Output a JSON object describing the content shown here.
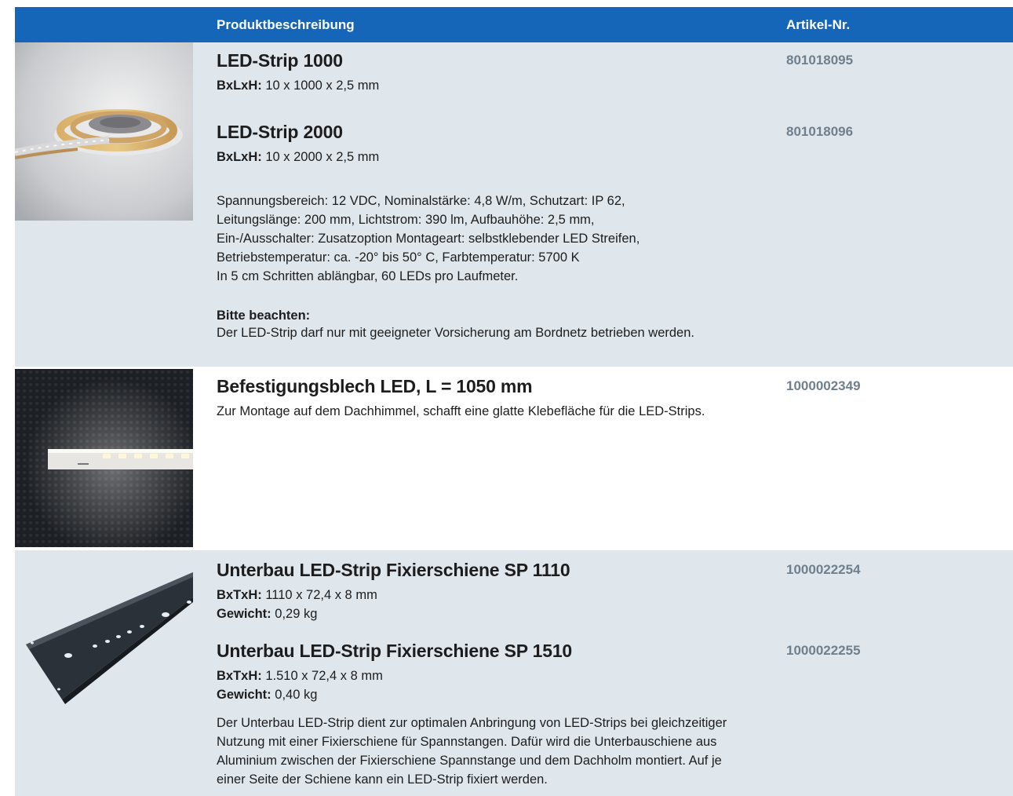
{
  "header": {
    "description": "Produktbeschreibung",
    "article_no": "Artikel-Nr."
  },
  "products": {
    "led_strip": {
      "image_icon": "led-strip-reel-photo",
      "items": [
        {
          "title": "LED-Strip 1000",
          "dim_label": "BxLxH:",
          "dim_value": " 10 x 1000 x 2,5 mm",
          "article": "801018095"
        },
        {
          "title": "LED-Strip 2000",
          "dim_label": "BxLxH:",
          "dim_value": " 10 x 2000 x 2,5 mm",
          "article": "801018096"
        }
      ],
      "specs": [
        "Spannungsbereich: 12 VDC, Nominalstärke: 4,8 W/m, Schutzart: IP 62,",
        "Leitungslänge: 200 mm, Lichtstrom: 390 lm, Aufbauhöhe: 2,5 mm,",
        "Ein-/Ausschalter: Zusatzoption Montageart: selbstklebender LED Streifen,",
        "Betriebstemperatur: ca. -20° bis 50° C, Farbtemperatur: 5700 K",
        "In 5 cm Schritten ablängbar, 60 LEDs pro Laufmeter."
      ],
      "note_label": "Bitte beachten:",
      "note_text": "Der LED-Strip darf nur mit geeigneter Vorsicherung am Bordnetz betrieben werden."
    },
    "bracket": {
      "image_icon": "mounting-plate-photo",
      "title": "Befestigungsblech LED, L = 1050 mm",
      "description": "Zur Montage auf dem Dachhimmel, schafft eine glatte Klebefläche für die LED-Strips.",
      "article": "1000002349"
    },
    "rail": {
      "image_icon": "mounting-rail-photo",
      "items": [
        {
          "title": "Unterbau LED-Strip Fixierschiene SP 1110",
          "dim_label": "BxTxH:",
          "dim_value": " 1110 x 72,4 x 8 mm",
          "weight_label": "Gewicht:",
          "weight_value": " 0,29 kg",
          "article": "1000022254"
        },
        {
          "title": "Unterbau LED-Strip Fixierschiene SP 1510",
          "dim_label": "BxTxH:",
          "dim_value": " 1.510 x 72,4 x 8 mm",
          "weight_label": "Gewicht:",
          "weight_value": " 0,40 kg",
          "article": "1000022255"
        }
      ],
      "description": [
        "Der Unterbau LED-Strip dient zur optimalen Anbringung von LED-Strips bei gleichzeitiger",
        "Nutzung mit einer Fixierschiene für Spannstangen. Dafür wird die Unterbauschiene aus",
        "Aluminium zwischen der Fixierschiene Spannstange und dem Dachholm montiert. Auf je",
        "einer Seite der Schiene kann ein LED-Strip fixiert werden."
      ]
    }
  },
  "colors": {
    "header_bg": "#1565b8",
    "row_alt_bg": "#dfe6ec",
    "article_text": "#6f7f8c"
  }
}
